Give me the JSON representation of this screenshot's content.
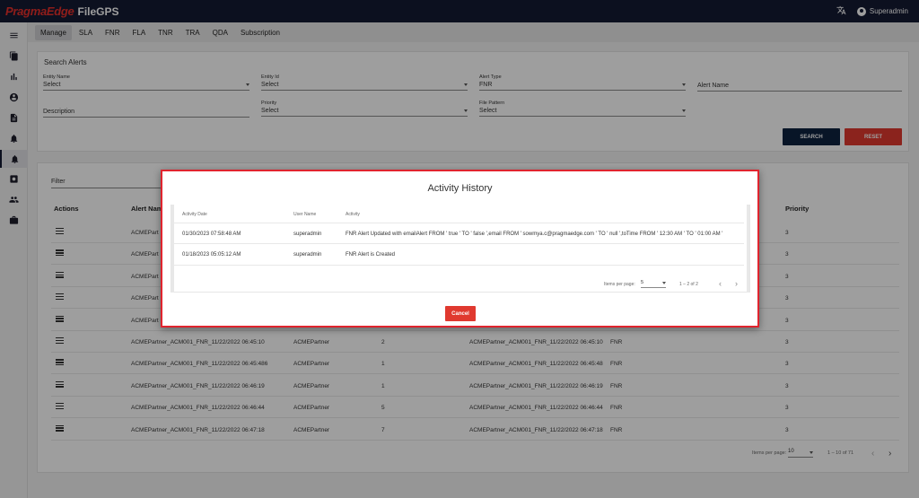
{
  "app": {
    "brand_primary": "PragmaEdge",
    "brand_secondary": "FileGPS",
    "user": "Superadmin",
    "translate_icon": "translate-icon",
    "accent": "#e0392f",
    "navy": "#141a33"
  },
  "sidebar": {
    "items": [
      "menu-icon",
      "file-icon",
      "chart-icon",
      "account-icon",
      "document-icon",
      "alert-icon",
      "alert-active-icon",
      "settings-icon",
      "users-icon",
      "briefcase-icon"
    ]
  },
  "tabs": [
    "Manage",
    "SLA",
    "FNR",
    "FLA",
    "TNR",
    "TRA",
    "QDA",
    "Subscription"
  ],
  "search": {
    "title": "Search Alerts",
    "entity_name": {
      "label": "Entity Name",
      "value": "Select"
    },
    "entity_id": {
      "label": "Entity Id",
      "value": "Select"
    },
    "alert_type": {
      "label": "Alert Type",
      "value": "FNR"
    },
    "alert_name": {
      "placeholder": "Alert Name"
    },
    "description": {
      "placeholder": "Description"
    },
    "priority": {
      "label": "Priority",
      "value": "Select"
    },
    "file_pattern": {
      "label": "File Pattern",
      "value": "Select"
    },
    "search_label": "SEARCH",
    "reset_label": "RESET"
  },
  "table": {
    "filter_placeholder": "Filter",
    "headers": {
      "actions": "Actions",
      "alert_name": "Alert Name",
      "priority": "Priority"
    },
    "rows": [
      {
        "alert_name": "ACMEPart",
        "partner": "",
        "count": "",
        "file": "",
        "type": "",
        "priority": "3"
      },
      {
        "alert_name": "ACMEPart",
        "partner": "",
        "count": "",
        "file": "",
        "type": "",
        "priority": "3"
      },
      {
        "alert_name": "ACMEPart",
        "partner": "",
        "count": "",
        "file": "",
        "type": "",
        "priority": "3"
      },
      {
        "alert_name": "ACMEPart",
        "partner": "",
        "count": "",
        "file": "",
        "type": "",
        "priority": "3"
      },
      {
        "alert_name": "ACMEPart",
        "partner": "",
        "count": "",
        "file": "",
        "type": "",
        "priority": "3"
      },
      {
        "alert_name": "ACMEPartner_ACM001_FNR_11/22/2022 06:45:10",
        "partner": "ACMEPartner",
        "count": "2",
        "file": "ACMEPartner_ACM001_FNR_11/22/2022 06:45:10",
        "type": "FNR",
        "priority": "3"
      },
      {
        "alert_name": "ACMEPartner_ACM001_FNR_11/22/2022 06:45:486",
        "partner": "ACMEPartner",
        "count": "1",
        "file": "ACMEPartner_ACM001_FNR_11/22/2022 06:45:48",
        "type": "FNR",
        "priority": "3"
      },
      {
        "alert_name": "ACMEPartner_ACM001_FNR_11/22/2022 06:46:19",
        "partner": "ACMEPartner",
        "count": "1",
        "file": "ACMEPartner_ACM001_FNR_11/22/2022 06:46:19",
        "type": "FNR",
        "priority": "3"
      },
      {
        "alert_name": "ACMEPartner_ACM001_FNR_11/22/2022 06:46:44",
        "partner": "ACMEPartner",
        "count": "5",
        "file": "ACMEPartner_ACM001_FNR_11/22/2022 06:46:44",
        "type": "FNR",
        "priority": "3"
      },
      {
        "alert_name": "ACMEPartner_ACM001_FNR_11/22/2022 06:47:18",
        "partner": "ACMEPartner",
        "count": "7",
        "file": "ACMEPartner_ACM001_FNR_11/22/2022 06:47:18",
        "type": "FNR",
        "priority": "3"
      }
    ],
    "pager": {
      "label": "Items per page:",
      "size": "10",
      "range": "1 – 10 of 71"
    }
  },
  "modal": {
    "title": "Activity History",
    "headers": {
      "date": "Activity Date",
      "user": "User Name",
      "activity": "Activity"
    },
    "rows": [
      {
        "date": "01/30/2023 07:58:48 AM",
        "user": "superadmin",
        "activity": "FNR Alert Updated with emailAlert FROM ' true ' TO ' false ',email FROM ' sowmya.c@pragmaedge.com ' TO ' null ',toTime FROM ' 12:30 AM ' TO ' 01:00 AM '"
      },
      {
        "date": "01/18/2023 05:05:12 AM",
        "user": "superadmin",
        "activity": "FNR Alert is Created"
      }
    ],
    "pager": {
      "label": "Items per page:",
      "size": "5",
      "range": "1 – 2 of 2"
    },
    "cancel_label": "Cancel"
  }
}
